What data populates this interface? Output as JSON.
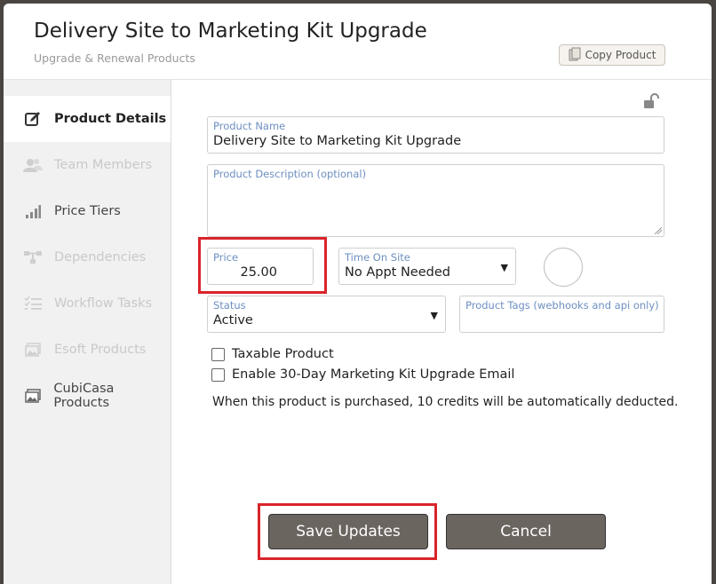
{
  "background": {
    "text": ""
  },
  "header": {
    "title": "Delivery Site to Marketing Kit Upgrade",
    "subtitle": "Upgrade & Renewal Products",
    "copy_label": "Copy Product"
  },
  "sidebar": {
    "items": [
      {
        "label": "Product Details",
        "icon": "edit-icon",
        "state": "active"
      },
      {
        "label": "Team Members",
        "icon": "users-icon",
        "state": "disabled"
      },
      {
        "label": "Price Tiers",
        "icon": "bars-icon",
        "state": "normal"
      },
      {
        "label": "Dependencies",
        "icon": "dependency-icon",
        "state": "disabled"
      },
      {
        "label": "Workflow Tasks",
        "icon": "tasks-icon",
        "state": "disabled"
      },
      {
        "label": "Esoft Products",
        "icon": "image-icon",
        "state": "disabled"
      },
      {
        "label": "CubiCasa Products",
        "icon": "image-icon",
        "state": "normal"
      }
    ]
  },
  "form": {
    "product_name": {
      "label": "Product Name",
      "value": "Delivery Site to Marketing Kit Upgrade"
    },
    "product_description": {
      "label": "Product Description (optional)",
      "value": ""
    },
    "price": {
      "label": "Price",
      "value": "25.00"
    },
    "time_on_site": {
      "label": "Time On Site",
      "value": "No Appt Needed"
    },
    "status": {
      "label": "Status",
      "value": "Active"
    },
    "product_tags": {
      "label": "Product Tags (webhooks and api only)",
      "value": ""
    },
    "taxable_label": "Taxable Product",
    "enable_email_label": "Enable 30-Day Marketing Kit Upgrade Email",
    "info_text": "When this product is purchased, 10 credits will be automatically deducted."
  },
  "actions": {
    "save_label": "Save Updates",
    "cancel_label": "Cancel"
  },
  "colors": {
    "highlight": "#d9242a",
    "button": "#6b6560",
    "label_blue": "#6d8fc1"
  }
}
